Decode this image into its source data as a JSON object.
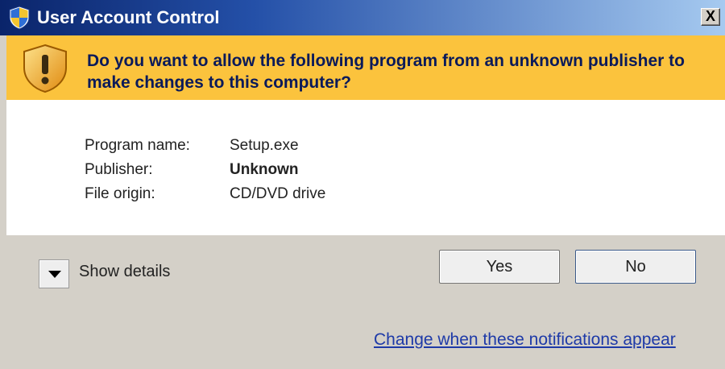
{
  "window": {
    "title": "User Account Control",
    "close_label": "X"
  },
  "banner": {
    "message": "Do you want to allow the following program from an unknown publisher to make changes to this computer?"
  },
  "info": {
    "program_name_label": "Program name:",
    "program_name_value": "Setup.exe",
    "publisher_label": "Publisher:",
    "publisher_value": "Unknown",
    "file_origin_label": "File origin:",
    "file_origin_value": "CD/DVD drive"
  },
  "actions": {
    "show_details_label": "Show details",
    "yes_label": "Yes",
    "no_label": "No",
    "notifications_link": "Change when these notifications appear"
  },
  "colors": {
    "banner": "#fbc33d",
    "title_gradient_start": "#0a246a",
    "link": "#1e3aa8"
  },
  "icons": {
    "title_icon": "uac-shield-icon",
    "banner_icon": "warning-shield-icon",
    "details_toggle": "chevron-down-icon"
  }
}
